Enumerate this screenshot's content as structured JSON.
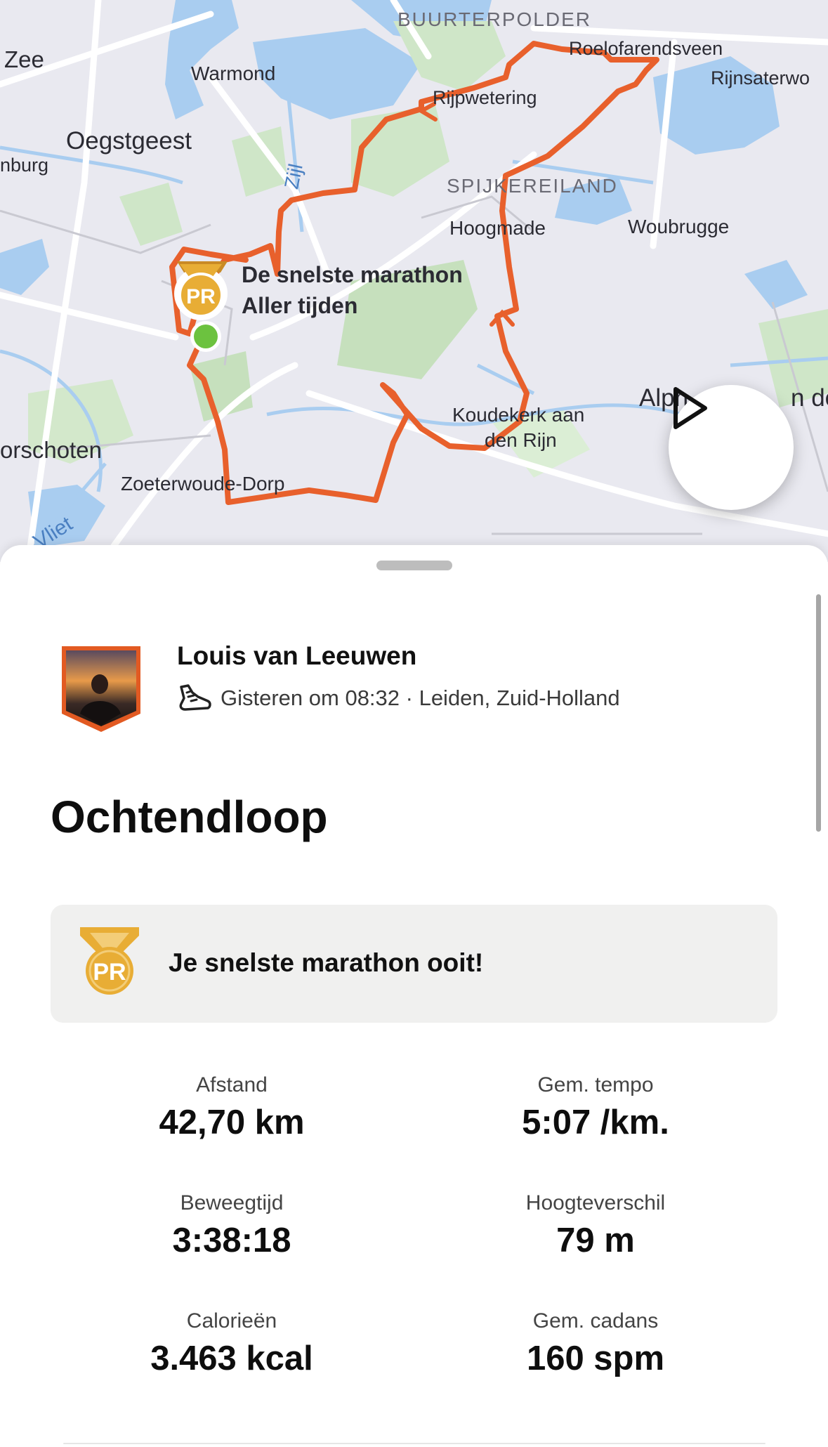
{
  "map": {
    "place_labels": [
      "BUURTERPOLDER",
      "Zee",
      "Warmond",
      "Roelofarendsveen",
      "Rijnsaterwo",
      "Rijpwetering",
      "Oegstgeest",
      "nburg",
      "Zijl",
      "SPIJKEREILAND",
      "Hoogmade",
      "Woubrugge",
      "Alph",
      "n de",
      "Koudekerk aan",
      "den Rijn",
      "orschoten",
      "Zoeterwoude-Dorp",
      "Vliet"
    ],
    "pr_marker_badge": "PR",
    "pr_label_line1": "De snelste marathon",
    "pr_label_line2": "Aller tijden",
    "route_color": "#e8602c",
    "start_color": "#6cc23f"
  },
  "activity": {
    "athlete_name": "Louis van Leeuwen",
    "meta": "Gisteren om 08:32 · Leiden, Zuid-Holland",
    "sport_icon": "running-shoe-icon",
    "title": "Ochtendloop"
  },
  "achievement": {
    "badge": "PR",
    "text": "Je snelste marathon ooit!"
  },
  "stats": [
    {
      "label": "Afstand",
      "value": "42,70 km"
    },
    {
      "label": "Gem. tempo",
      "value": "5:07 /km."
    },
    {
      "label": "Beweegtijd",
      "value": "3:38:18"
    },
    {
      "label": "Hoogteverschil",
      "value": "79 m"
    },
    {
      "label": "Calorieën",
      "value": "3.463 kcal"
    },
    {
      "label": "Gem. cadans",
      "value": "160 spm"
    }
  ],
  "colors": {
    "accent": "#e8602c",
    "pr_gold": "#e8ad35",
    "card_bg": "#f0f0ef"
  }
}
